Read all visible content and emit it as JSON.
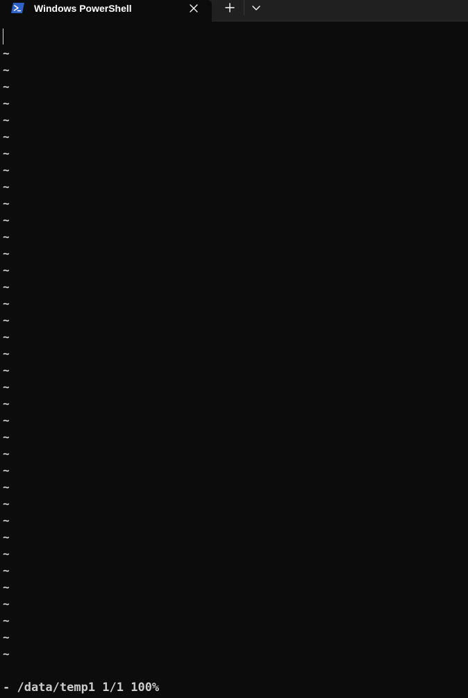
{
  "tabbar": {
    "tab": {
      "title": "Windows PowerShell",
      "icon": "powershell-icon",
      "close_icon": "close-icon"
    },
    "new_tab_icon": "plus-icon",
    "dropdown_icon": "chevron-down-icon"
  },
  "terminal": {
    "empty_line_marker": "~",
    "empty_line_count": 37,
    "status_line": "- /data/temp1 1/1 100%"
  },
  "colors": {
    "background": "#0c0c0c",
    "tabbar": "#202020",
    "text": "#cccccc",
    "powershell_blue": "#2d62c8"
  }
}
